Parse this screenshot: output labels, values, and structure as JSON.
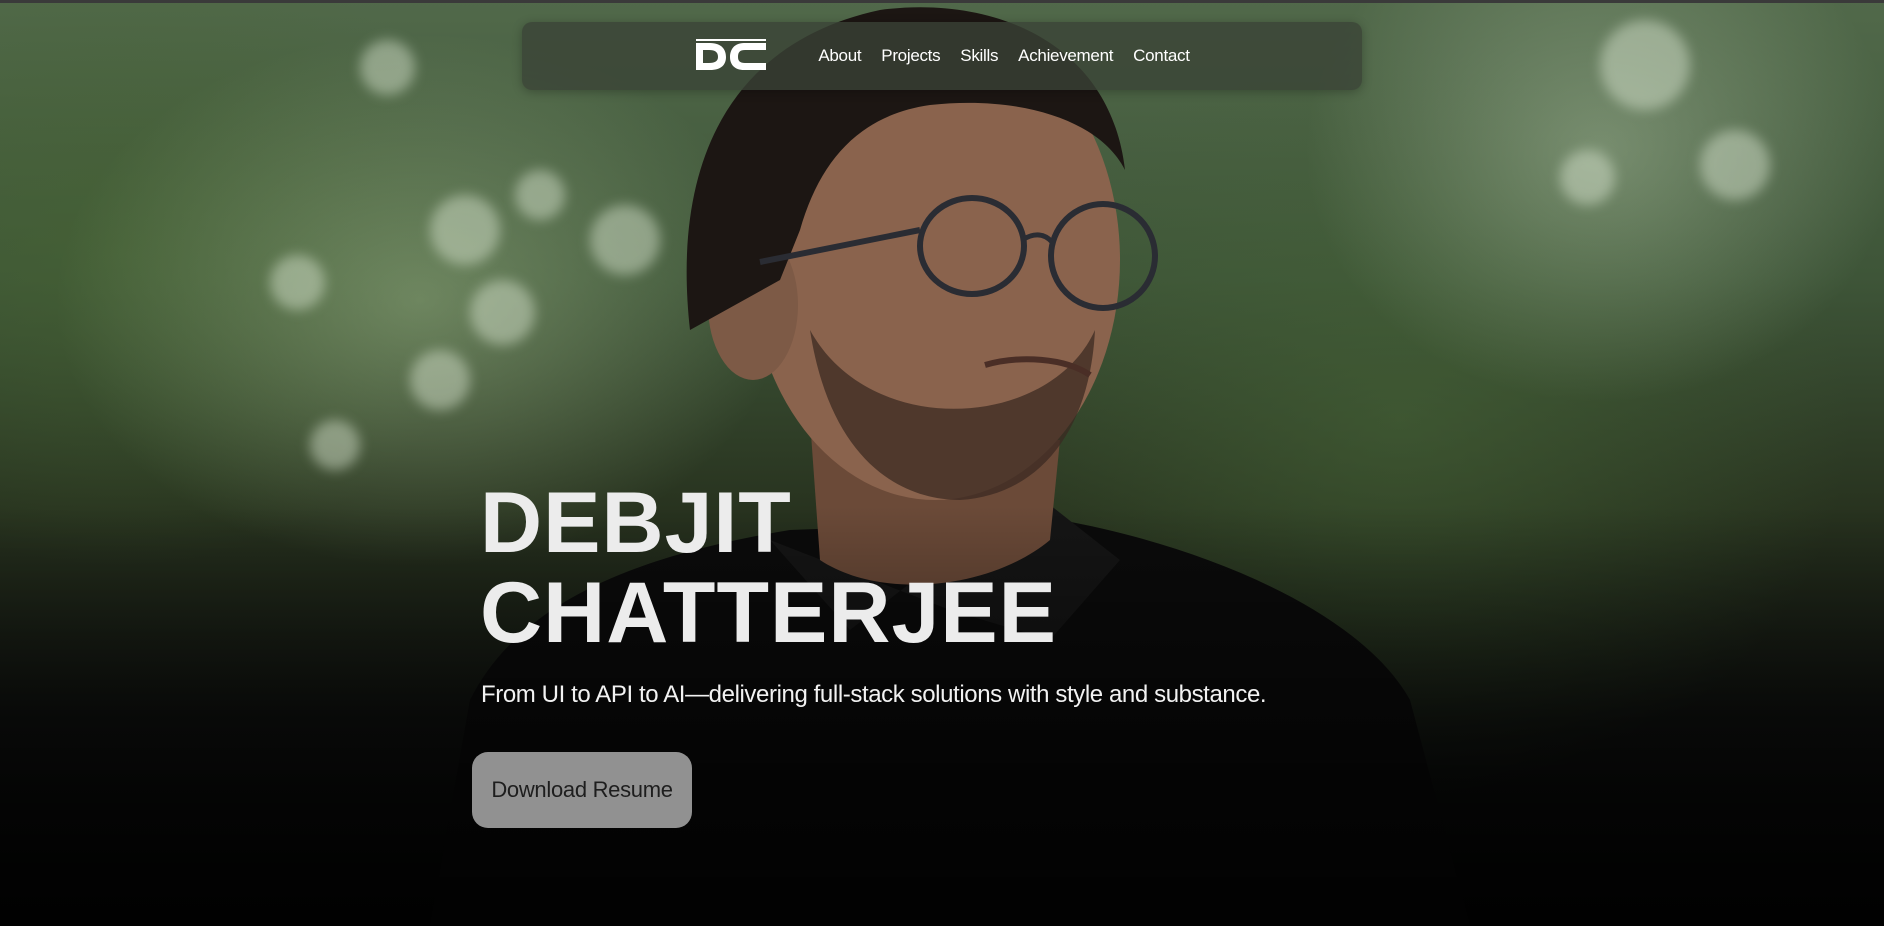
{
  "nav": {
    "logo_icon": "dc-logo-icon",
    "links": [
      "About",
      "Projects",
      "Skills",
      "Achievement",
      "Contact"
    ]
  },
  "hero": {
    "name_line1": "DEBJIT",
    "name_line2": "CHATTERJEE",
    "tagline": "From UI to API to AI—delivering full-stack solutions with style and substance.",
    "cta_label": "Download Resume"
  },
  "colors": {
    "text": "#ececec",
    "nav_bg": "#3a4236",
    "button_bg": "#aaaaaa"
  }
}
